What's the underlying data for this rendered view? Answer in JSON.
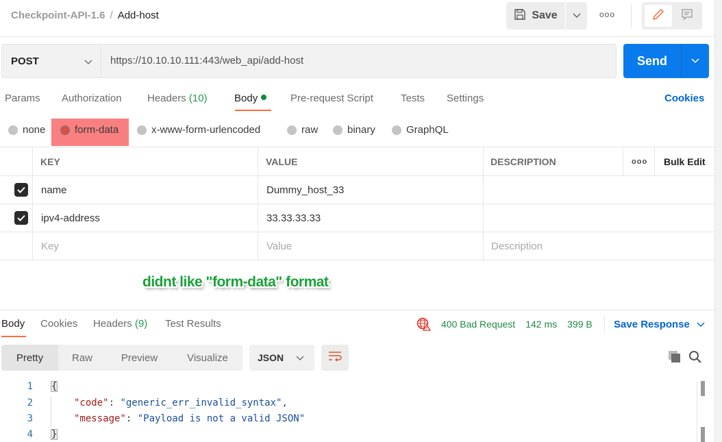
{
  "header": {
    "collection": "Checkpoint-API-1.6",
    "separator": "/",
    "request_name": "Add-host",
    "save_label": "Save",
    "more_label": "ooo"
  },
  "request": {
    "method": "POST",
    "url": "https://10.10.10.111:443/web_api/add-host",
    "send_label": "Send"
  },
  "tabs": [
    {
      "label": "Params"
    },
    {
      "label": "Authorization"
    },
    {
      "label": "Headers",
      "count": "(10)"
    },
    {
      "label": "Body",
      "active": true,
      "indicator": "green-dot"
    },
    {
      "label": "Pre-request Script"
    },
    {
      "label": "Tests"
    },
    {
      "label": "Settings"
    }
  ],
  "cookies_label": "Cookies",
  "body_types": [
    {
      "label": "none",
      "selected": false
    },
    {
      "label": "form-data",
      "selected": true
    },
    {
      "label": "x-www-form-urlencoded",
      "selected": false
    },
    {
      "label": "raw",
      "selected": false
    },
    {
      "label": "binary",
      "selected": false
    },
    {
      "label": "GraphQL",
      "selected": false
    }
  ],
  "form_table": {
    "headers": {
      "key": "KEY",
      "value": "VALUE",
      "description": "DESCRIPTION",
      "more": "ooo",
      "bulk_edit": "Bulk Edit"
    },
    "rows": [
      {
        "checked": true,
        "key": "name",
        "value": "Dummy_host_33",
        "description": ""
      },
      {
        "checked": true,
        "key": "ipv4-address",
        "value": "33.33.33.33",
        "description": ""
      }
    ],
    "placeholders": {
      "key": "Key",
      "value": "Value",
      "description": "Description"
    }
  },
  "annotation": "didnt like \"form-data\" format",
  "response": {
    "tabs": [
      {
        "label": "Body",
        "active": true
      },
      {
        "label": "Cookies"
      },
      {
        "label": "Headers",
        "count": "(9)"
      },
      {
        "label": "Test Results"
      }
    ],
    "status": "400 Bad Request",
    "time": "142 ms",
    "size": "399 B",
    "save_response_label": "Save Response",
    "view_modes": [
      "Pretty",
      "Raw",
      "Preview",
      "Visualize"
    ],
    "active_view": "Pretty",
    "format": "JSON",
    "code_lines": [
      {
        "n": "1"
      },
      {
        "n": "2",
        "key": "\"code\"",
        "value": "\"generic_err_invalid_syntax\","
      },
      {
        "n": "3",
        "key": "\"message\"",
        "value": "\"Payload is not a valid JSON\""
      },
      {
        "n": "4"
      }
    ],
    "open_brace": "{",
    "close_brace": "}",
    "colon": ": "
  },
  "colors": {
    "accent": "#ff6c37",
    "send": "#097bed",
    "link": "#0265d2",
    "status_ok_text": "#1f8a44",
    "error_icon": "#e0352b",
    "highlight": "#f97f80",
    "annotation": "#1aa23a"
  }
}
